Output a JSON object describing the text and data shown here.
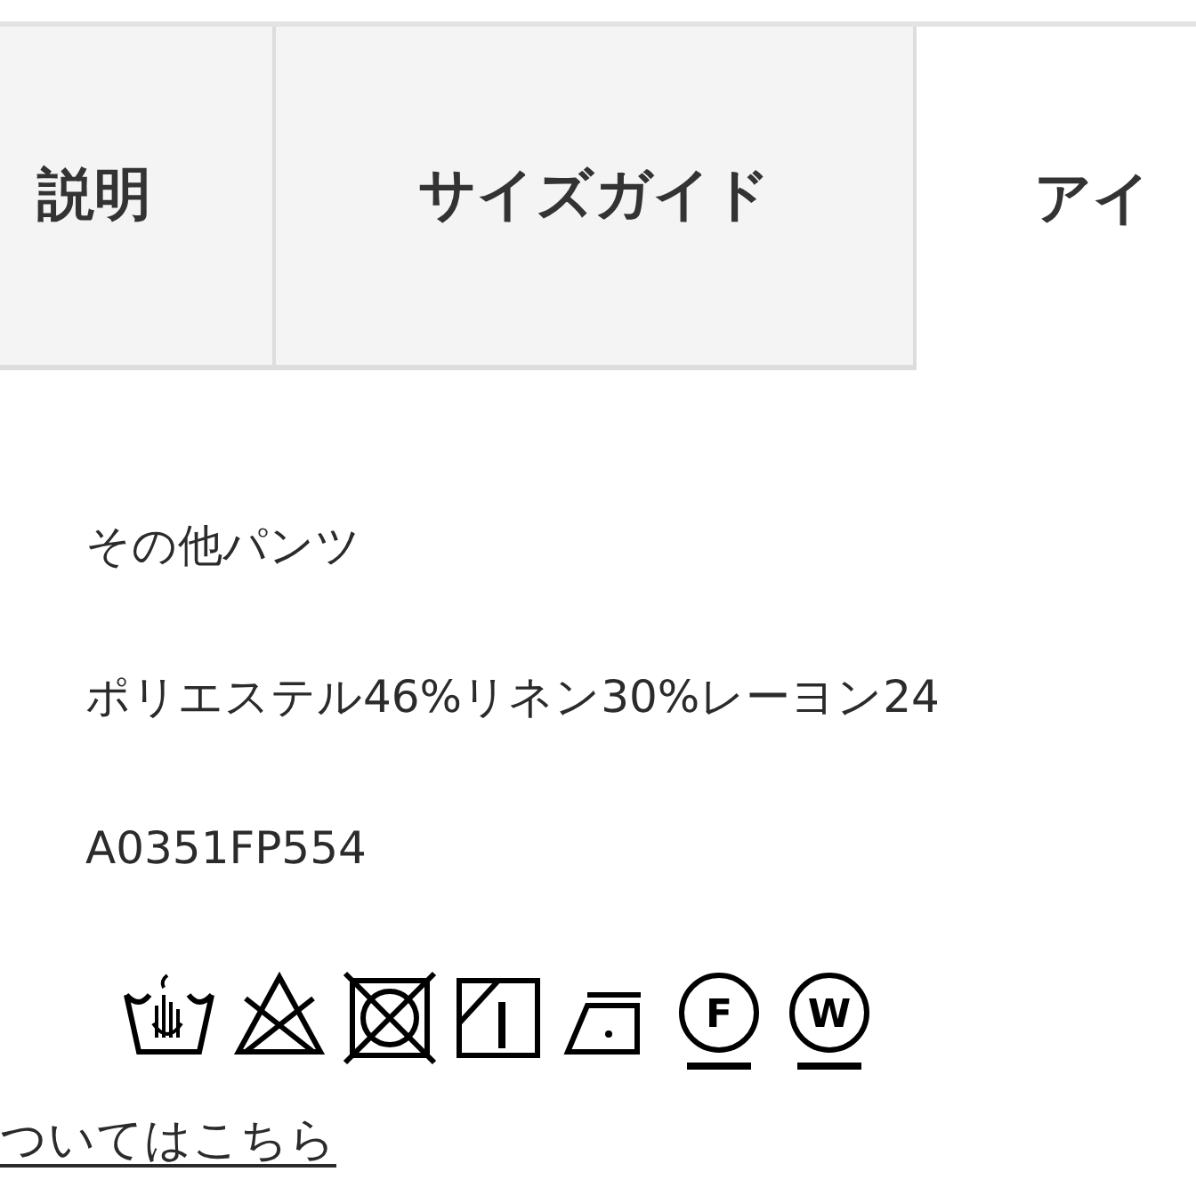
{
  "tabs": [
    {
      "label": "説明",
      "selected": false
    },
    {
      "label": "サイズガイド",
      "selected": false
    },
    {
      "label": "アイ",
      "selected": true
    }
  ],
  "details": [
    "その他パンツ",
    "ポリエステル46%リネン30%レーヨン24",
    "A0351FP554"
  ],
  "care_symbols": [
    {
      "kind": "handwash"
    },
    {
      "kind": "no-bleach"
    },
    {
      "kind": "no-tumble"
    },
    {
      "kind": "line-dry"
    },
    {
      "kind": "iron-low"
    },
    {
      "kind": "circle",
      "letter": "F"
    },
    {
      "kind": "circle",
      "letter": "W"
    }
  ],
  "link": "ついてはこちら"
}
